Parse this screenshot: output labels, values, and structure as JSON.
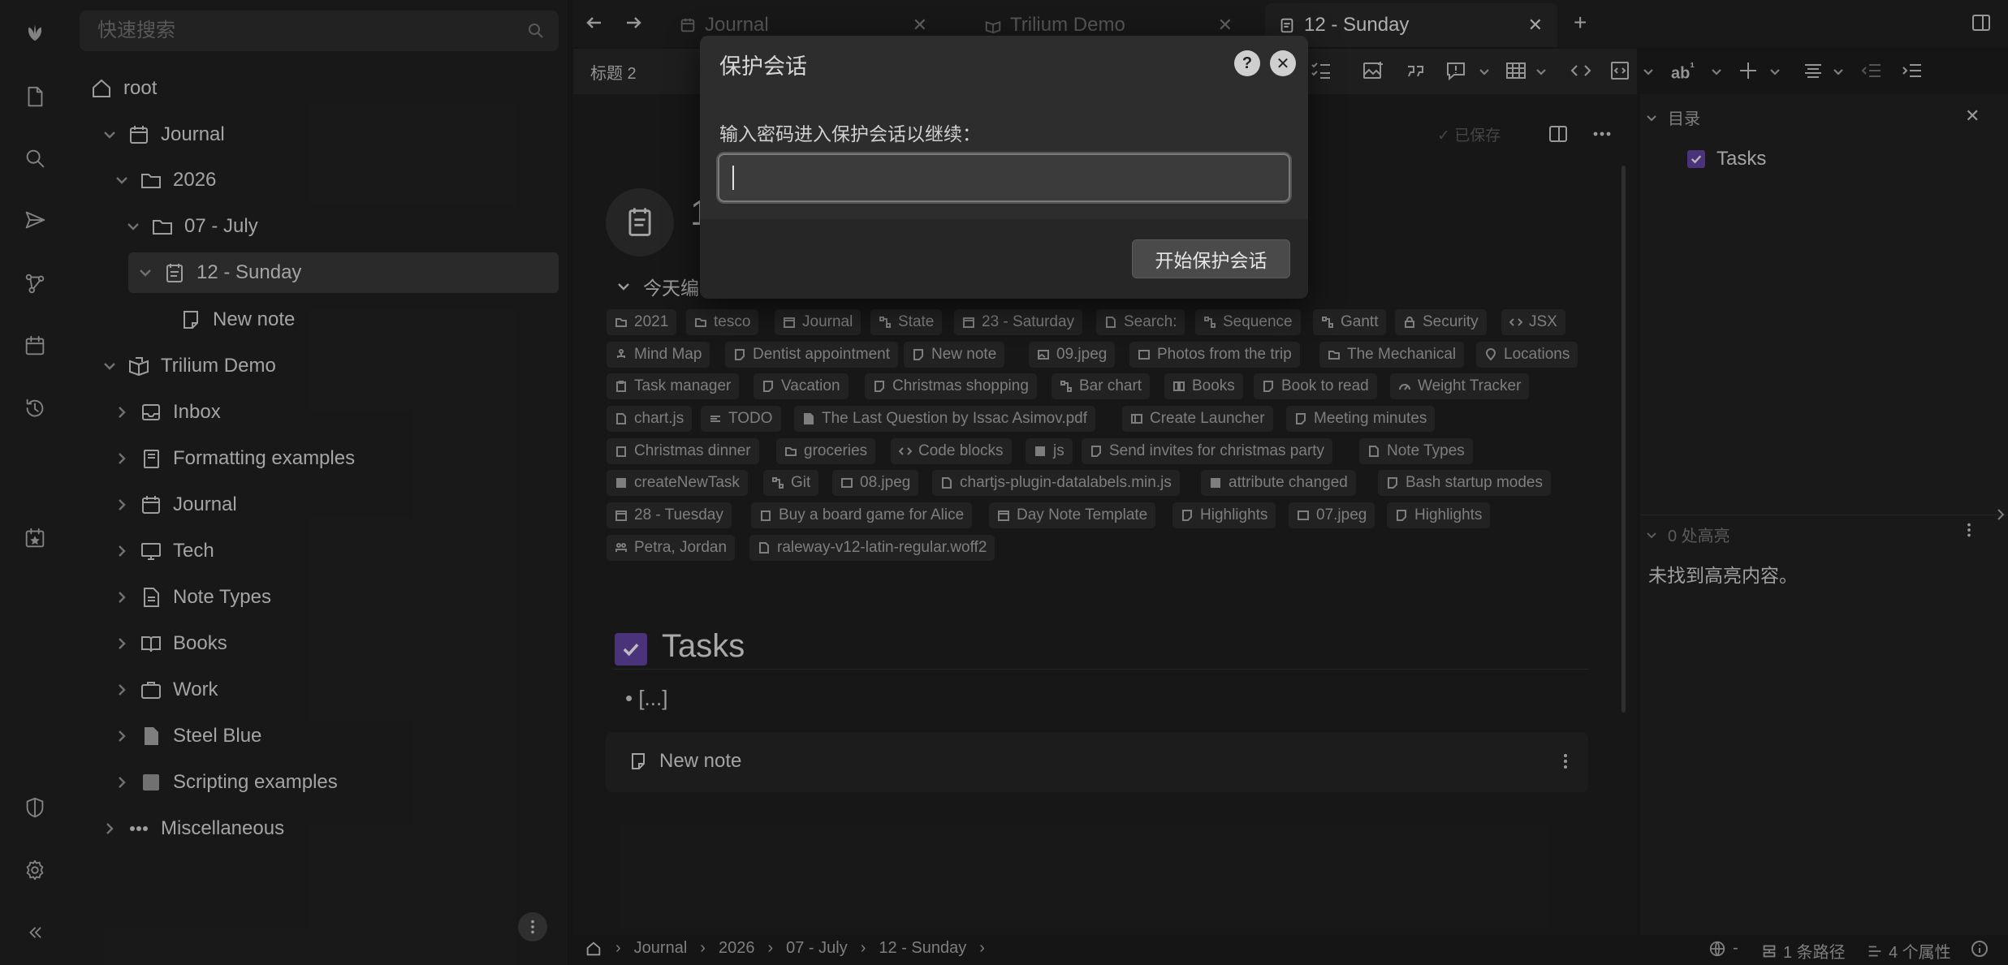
{
  "search": {
    "placeholder": "快速搜索"
  },
  "tree": {
    "root": "root",
    "journal": "Journal",
    "y2026": "2026",
    "july": "07 - July",
    "sunday": "12 - Sunday",
    "new_note": "New note",
    "trilium_demo": "Trilium Demo",
    "inbox": "Inbox",
    "formatting": "Formatting examples",
    "journal2": "Journal",
    "tech": "Tech",
    "note_types": "Note Types",
    "books": "Books",
    "work": "Work",
    "steel_blue": "Steel Blue",
    "scripting": "Scripting examples",
    "misc": "Miscellaneous"
  },
  "tabs": [
    {
      "label": "Journal"
    },
    {
      "label": "Trilium Demo"
    },
    {
      "label": "12 - Sunday"
    }
  ],
  "toolbar": {
    "heading": "标题 2"
  },
  "note": {
    "saved": "已保存",
    "edited_today": "今天编",
    "title_initial": "1",
    "tasks_heading": "Tasks",
    "tasks_bullet": "[...]",
    "child_new_note": "New note"
  },
  "chips": [
    [
      "2021",
      "tesco",
      "Journal",
      "State",
      "23 - Saturday",
      "Search:",
      "Sequence",
      "Gantt",
      "Security",
      "JSX"
    ],
    [
      "Mind Map",
      "Dentist appointment",
      "New note",
      "09.jpeg",
      "Photos from the trip",
      "The Mechanical",
      "Locations"
    ],
    [
      "Task manager",
      "Vacation",
      "Christmas shopping",
      "Bar chart",
      "Books",
      "Book to read",
      "Weight Tracker"
    ],
    [
      "chart.js",
      "TODO",
      "The Last Question by Issac Asimov.pdf",
      "Create Launcher",
      "Meeting minutes"
    ],
    [
      "Christmas dinner",
      "groceries",
      "Code blocks",
      "js",
      "Send invites for christmas party",
      "Note Types"
    ],
    [
      "createNewTask",
      "Git",
      "08.jpeg",
      "chartjs-plugin-datalabels.min.js",
      "attribute changed",
      "Bash startup modes"
    ],
    [
      "28 - Tuesday",
      "Buy a board game for Alice",
      "Day Note Template",
      "Highlights",
      "07.jpeg",
      "Highlights"
    ],
    [
      "Petra, Jordan",
      "raleway-v12-latin-regular.woff2"
    ]
  ],
  "right_panel": {
    "toc_title": "目录",
    "toc_item": "Tasks",
    "highlights_title": "0 处高亮",
    "highlights_empty": "未找到高亮内容。"
  },
  "breadcrumb": [
    "Journal",
    "2026",
    "07 - July",
    "12 - Sunday"
  ],
  "status": {
    "lang": "-",
    "paths": "1 条路径",
    "attrs": "4 个属性"
  },
  "dialog": {
    "title": "保护会话",
    "prompt": "输入密码进入保护会话以继续：",
    "password_value": "",
    "submit": "开始保护会话",
    "help": "?"
  },
  "colors": {
    "accent": "#5b3f97",
    "background": "#1d1d1d",
    "panel": "#1e1e1e"
  }
}
